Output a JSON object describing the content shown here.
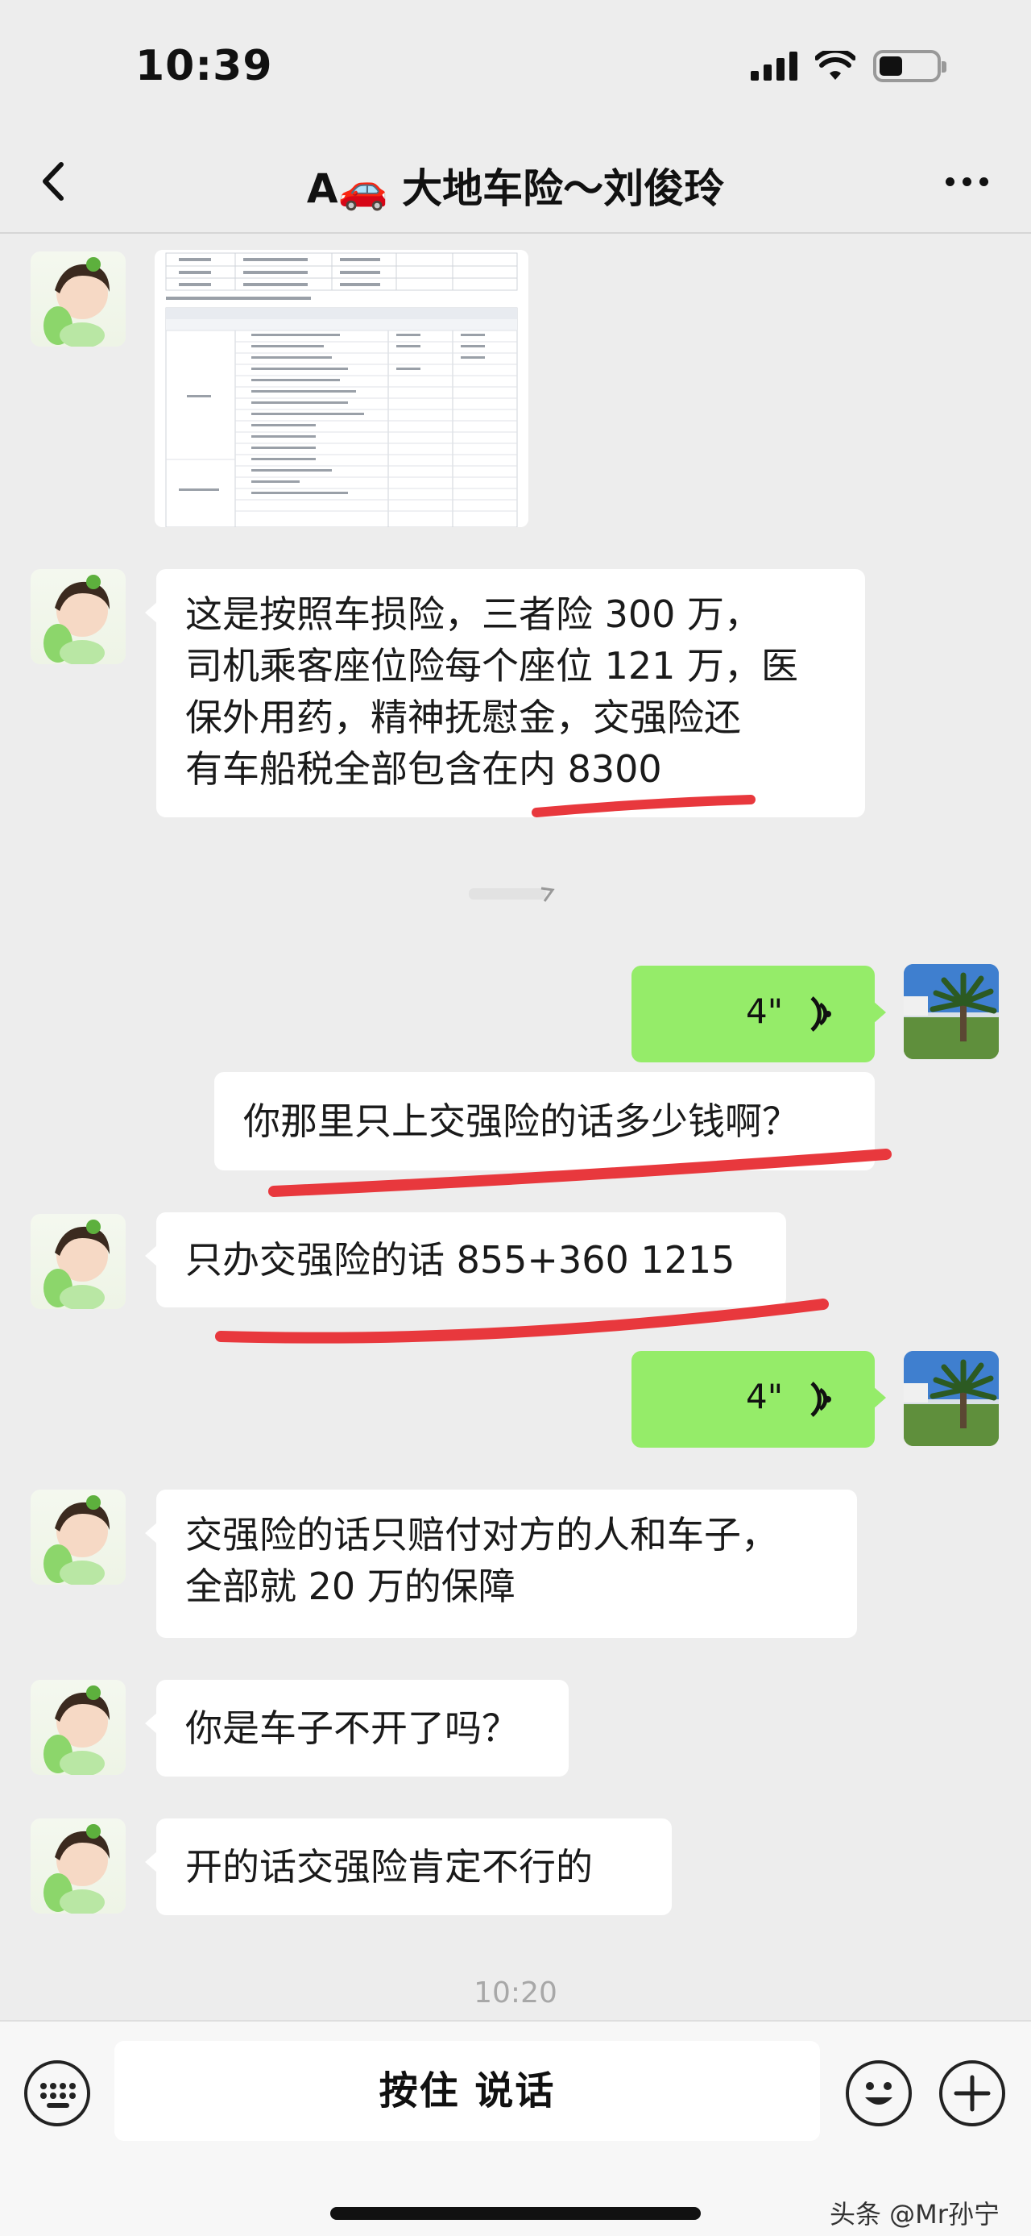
{
  "status_bar": {
    "time": "10:39"
  },
  "nav": {
    "title": "A🚗 大地车险～刘俊玲"
  },
  "messages": [
    {
      "side": "left",
      "type": "image",
      "description_label": ""
    },
    {
      "side": "left",
      "type": "text",
      "lines": [
        "这是按照车损险，三者险 300 万，",
        "司机乘客座位险每个座位 121 万，医",
        "保外用药，精神抚慰金，交强险还",
        "有车船税全部包含在内 8300"
      ]
    },
    {
      "side": "right",
      "type": "voice",
      "duration": "4\""
    },
    {
      "side": "right",
      "type": "text",
      "text": "你那里只上交强险的话多少钱啊？"
    },
    {
      "side": "left",
      "type": "text",
      "text": "只办交强险的话 855+360  1215"
    },
    {
      "side": "right",
      "type": "voice",
      "duration": "4\""
    },
    {
      "side": "left",
      "type": "text",
      "lines": [
        "交强险的话只赔付对方的人和车子，",
        "全部就 20 万的保障"
      ]
    },
    {
      "side": "left",
      "type": "text",
      "text": "你是车子不开了吗？"
    },
    {
      "side": "left",
      "type": "text",
      "text": "开的话交强险肯定不行的"
    }
  ],
  "timestamp": "10:20",
  "input_bar": {
    "hold_to_talk": "按住 说话"
  },
  "watermark": "头条 @Mr孙宁",
  "colors": {
    "background": "#ededed",
    "self_bubble": "#95ec69",
    "other_bubble": "#ffffff",
    "underline": "#e8383d"
  }
}
